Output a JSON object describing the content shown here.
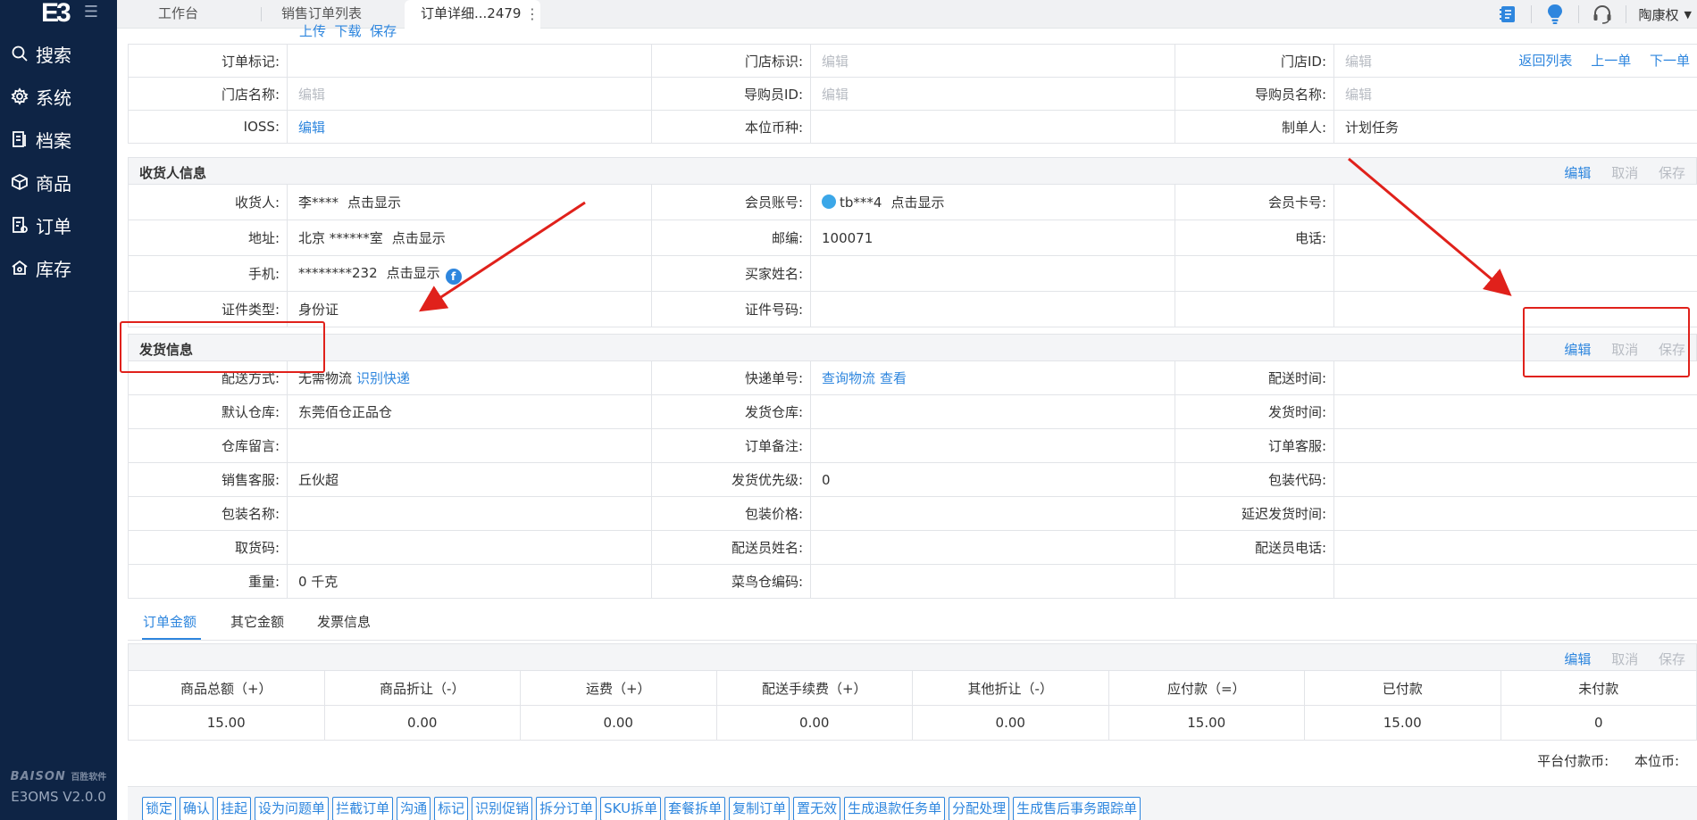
{
  "sidebar": {
    "logo": "E3",
    "items": [
      {
        "label": "搜索",
        "icon": "search-icon"
      },
      {
        "label": "系统",
        "icon": "gear-icon"
      },
      {
        "label": "档案",
        "icon": "document-icon"
      },
      {
        "label": "商品",
        "icon": "box-icon"
      },
      {
        "label": "订单",
        "icon": "order-icon"
      },
      {
        "label": "库存",
        "icon": "warehouse-icon"
      }
    ],
    "brand": "BAISON",
    "brand_cn": "百胜软件",
    "version": "E3OMS V2.0.0"
  },
  "tabs": [
    {
      "label": "工作台"
    },
    {
      "label": "销售订单列表"
    },
    {
      "label": "订单详细...2479"
    }
  ],
  "topbar": {
    "user": "陶康权",
    "icons": [
      "notebook-icon",
      "lightbulb-icon",
      "headset-icon"
    ]
  },
  "top_fragment": "上传  下载  保存",
  "nav_links": [
    "返回列表",
    "上一单",
    "下一单"
  ],
  "order_rows": [
    [
      {
        "l": "订单标记:",
        "v": ""
      },
      {
        "l": "门店标识:",
        "v": "编辑",
        "muted": true
      },
      {
        "l": "门店ID:",
        "v": "编辑",
        "muted": true
      }
    ],
    [
      {
        "l": "门店名称:",
        "v": "编辑",
        "muted": true
      },
      {
        "l": "导购员ID:",
        "v": "编辑",
        "muted": true
      },
      {
        "l": "导购员名称:",
        "v": "编辑",
        "muted": true
      }
    ],
    [
      {
        "l": "IOSS:",
        "v": "编辑",
        "link": true
      },
      {
        "l": "本位币种:",
        "v": ""
      },
      {
        "l": "制单人:",
        "v": "计划任务"
      }
    ]
  ],
  "receiver": {
    "title": "收货人信息",
    "actions": [
      "编辑",
      "取消",
      "保存"
    ],
    "rows": [
      [
        {
          "l": "收货人:",
          "v": "李****",
          "extra": "点击显示"
        },
        {
          "l": "会员账号:",
          "v": "tb***4",
          "extra": "点击显示",
          "qq": true
        },
        {
          "l": "会员卡号:",
          "v": ""
        }
      ],
      [
        {
          "l": "地址:",
          "v": "北京 ******室",
          "extra": "点击显示"
        },
        {
          "l": "邮编:",
          "v": "100071"
        },
        {
          "l": "电话:",
          "v": ""
        }
      ],
      [
        {
          "l": "手机:",
          "v": "********232",
          "extra": "点击显示",
          "fb": true
        },
        {
          "l": "买家姓名:",
          "v": ""
        },
        {
          "l": "",
          "v": ""
        }
      ],
      [
        {
          "l": "证件类型:",
          "v": "身份证"
        },
        {
          "l": "证件号码:",
          "v": ""
        },
        {
          "l": "",
          "v": ""
        }
      ]
    ]
  },
  "shipping": {
    "title": "发货信息",
    "actions": [
      "编辑",
      "取消",
      "保存"
    ],
    "rows": [
      [
        {
          "l": "配送方式:",
          "v": "无需物流",
          "linkextra": "识别快递"
        },
        {
          "l": "快递单号:",
          "v": "查询物流",
          "vlink": true,
          "linkextra": "查看"
        },
        {
          "l": "配送时间:",
          "v": ""
        }
      ],
      [
        {
          "l": "默认仓库:",
          "v": "东莞佰仓正品仓"
        },
        {
          "l": "发货仓库:",
          "v": ""
        },
        {
          "l": "发货时间:",
          "v": ""
        }
      ],
      [
        {
          "l": "仓库留言:",
          "v": ""
        },
        {
          "l": "订单备注:",
          "v": ""
        },
        {
          "l": "订单客服:",
          "v": ""
        }
      ],
      [
        {
          "l": "销售客服:",
          "v": "丘伙超"
        },
        {
          "l": "发货优先级:",
          "v": "0"
        },
        {
          "l": "包装代码:",
          "v": ""
        }
      ],
      [
        {
          "l": "包装名称:",
          "v": ""
        },
        {
          "l": "包装价格:",
          "v": ""
        },
        {
          "l": "延迟发货时间:",
          "v": ""
        }
      ],
      [
        {
          "l": "取货码:",
          "v": ""
        },
        {
          "l": "配送员姓名:",
          "v": ""
        },
        {
          "l": "配送员电话:",
          "v": ""
        }
      ],
      [
        {
          "l": "重量:",
          "v": "0 千克"
        },
        {
          "l": "菜鸟仓编码:",
          "v": ""
        },
        {
          "l": "",
          "v": ""
        }
      ]
    ]
  },
  "sub_tabs": [
    "订单金额",
    "其它金额",
    "发票信息"
  ],
  "amount": {
    "actions": [
      "编辑",
      "取消",
      "保存"
    ],
    "headers": [
      "商品总额（+）",
      "商品折让（-）",
      "运费（+）",
      "配送手续费（+）",
      "其他折让（-）",
      "应付款（=）",
      "已付款",
      "未付款"
    ],
    "values": [
      "15.00",
      "0.00",
      "0.00",
      "0.00",
      "0.00",
      "15.00",
      "15.00",
      "0"
    ]
  },
  "currency": [
    "平台付款币:",
    "本位币:"
  ],
  "action_buttons": [
    "锁定",
    "确认",
    "挂起",
    "设为问题单",
    "拦截订单",
    "沟通",
    "标记",
    "识别促销",
    "拆分订单",
    "SKU拆单",
    "套餐拆单",
    "复制订单",
    "置无效",
    "生成退款任务单",
    "分配处理",
    "生成售后事务跟踪单"
  ],
  "colors": {
    "sidebar": "#0e2445",
    "link": "#2e86de",
    "annotation": "#e0211b"
  }
}
